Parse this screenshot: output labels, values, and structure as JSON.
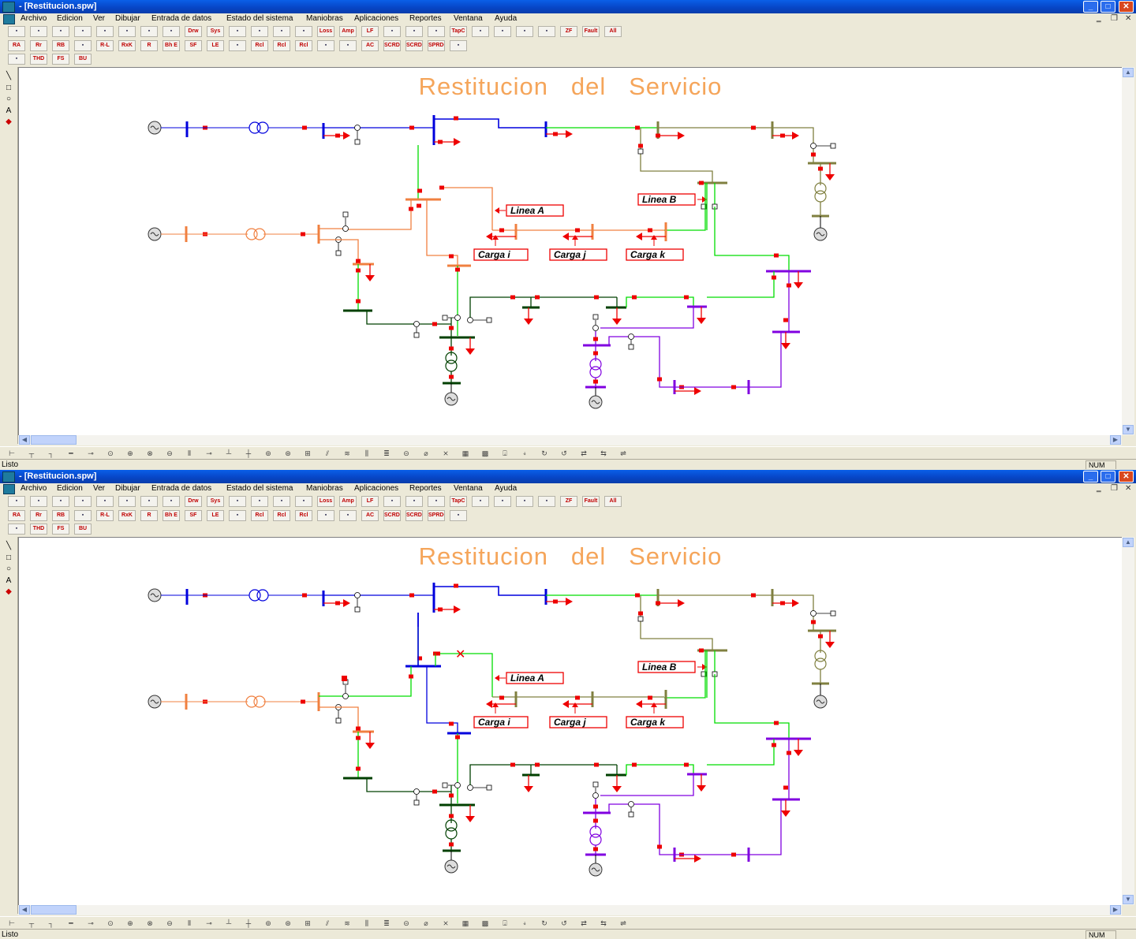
{
  "window": {
    "title": "- [Restitucion.spw]",
    "caption_buttons": {
      "minimize": "_",
      "maximize": "□",
      "close": "✕"
    }
  },
  "menu": [
    "Archivo",
    "Edicion",
    "Ver",
    "Dibujar",
    "Entrada de datos",
    "Estado del sistema",
    "Maniobras",
    "Aplicaciones",
    "Reportes",
    "Ventana",
    "Ayuda"
  ],
  "toolbar": {
    "row1": [
      "open-icon",
      "save-icon",
      "print-icon",
      "zoom-icon",
      "zoom-fit-icon",
      "zoom-in-icon",
      "zoom-out-icon",
      "pan-icon",
      "Drw Par",
      "Sys Par",
      "eraser-icon",
      "fault-icon",
      "check-icon",
      "switch-icon",
      "Loss",
      "Amp",
      "LF",
      "tap-icon",
      "ratio-icon",
      "tap-block-icon",
      "TapC",
      "bus-icon",
      "bus-icon",
      "bus-icon",
      "bus-icon",
      "ZF",
      "Fault",
      "All Faults"
    ],
    "row2": [
      "RA",
      "Rr",
      "RB",
      "relay-icon",
      "R-L",
      "RxK",
      "R",
      "Bh E",
      "SF",
      "LE",
      "box-icon",
      "Rcl",
      "Rcl",
      "Rcl",
      "line-icon",
      "box-icon",
      "AC",
      "SCRDA",
      "SCRDA S",
      "SPRDO S R",
      "tool-icon"
    ],
    "row3": [
      "chart-icon",
      "THD",
      "FS",
      "BU"
    ]
  },
  "left_tools": [
    "line-tool-icon",
    "rectangle-tool-icon",
    "ellipse-tool-icon",
    "text-tool-icon",
    "color-tool-icon"
  ],
  "draw_tools": [
    "bus-tool",
    "t-tool",
    "l-tool",
    "line-tool",
    "switch-tool",
    "generator-tool",
    "transformer-tool",
    "transformer3-tool",
    "motor-tool",
    "capacitor-tool",
    "reactor-tool",
    "breaker-tool",
    "load-tool",
    "load2-tool",
    "fuse-tool",
    "ground-tool",
    "relay-tool",
    "ct-tool",
    "pt-tool",
    "svc-tool",
    "filter-tool",
    "harmonic-tool",
    "dc-tool",
    "recloser-tool",
    "arrester-tool",
    "grid-tool",
    "grid2-tool",
    "rotate-tool",
    "flip-tool",
    "undo-tool",
    "redo-tool",
    "connect-tool"
  ],
  "status": {
    "left": "Listo",
    "right": "NUM"
  },
  "diagram": {
    "title": "Restitucion   del   Servicio",
    "line_a": "Linea  A",
    "line_b": "Linea  B",
    "load_i": "Carga  i",
    "load_j": "Carga  j",
    "load_k": "Carga  k"
  },
  "colors": {
    "bus_blue": "#0000dd",
    "bus_orange": "#f08040",
    "bus_green": "#00dd00",
    "bus_olive": "#808040",
    "bus_darkgreen": "#004000",
    "bus_purple": "#8000e0",
    "element_red": "#ee0000",
    "title_orange": "#f5a55a",
    "xp_blue": "#0744c4"
  }
}
